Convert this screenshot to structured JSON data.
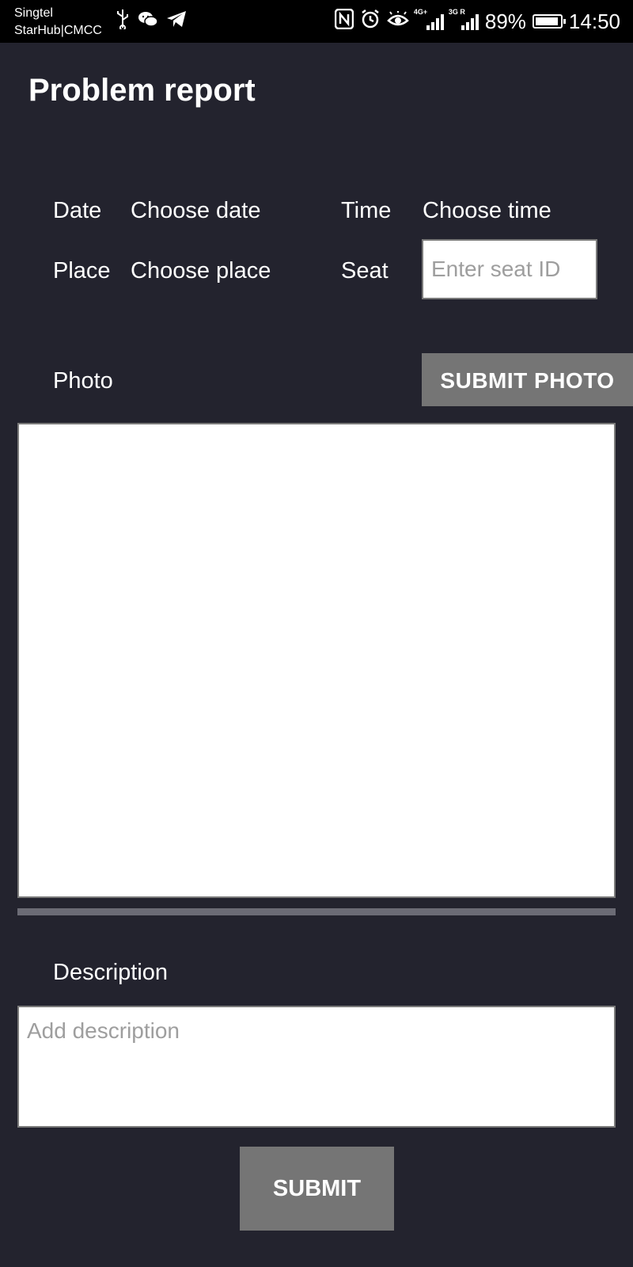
{
  "status_bar": {
    "carrier_line1": "Singtel",
    "carrier_line2": "StarHub|CMCC",
    "battery": "89%",
    "time": "14:50",
    "signal1_tag": "4G+",
    "signal2_tag": "3G R",
    "left_icons": [
      "usb-icon",
      "wechat-icon",
      "telegram-icon"
    ],
    "right_icons": [
      "nfc-icon",
      "alarm-icon",
      "eye-icon",
      "signal-icon",
      "signal-icon",
      "battery-icon"
    ]
  },
  "page": {
    "title": "Problem report"
  },
  "form": {
    "date_label": "Date",
    "date_value": "Choose date",
    "time_label": "Time",
    "time_value": "Choose time",
    "place_label": "Place",
    "place_value": "Choose place",
    "seat_label": "Seat",
    "seat_placeholder": "Enter seat ID",
    "photo_label": "Photo",
    "submit_photo_label": "SUBMIT PHOTO",
    "description_label": "Description",
    "description_placeholder": "Add description",
    "submit_label": "SUBMIT"
  },
  "colors": {
    "background": "#23232e",
    "button": "#757575",
    "divider": "#6b6b75"
  }
}
